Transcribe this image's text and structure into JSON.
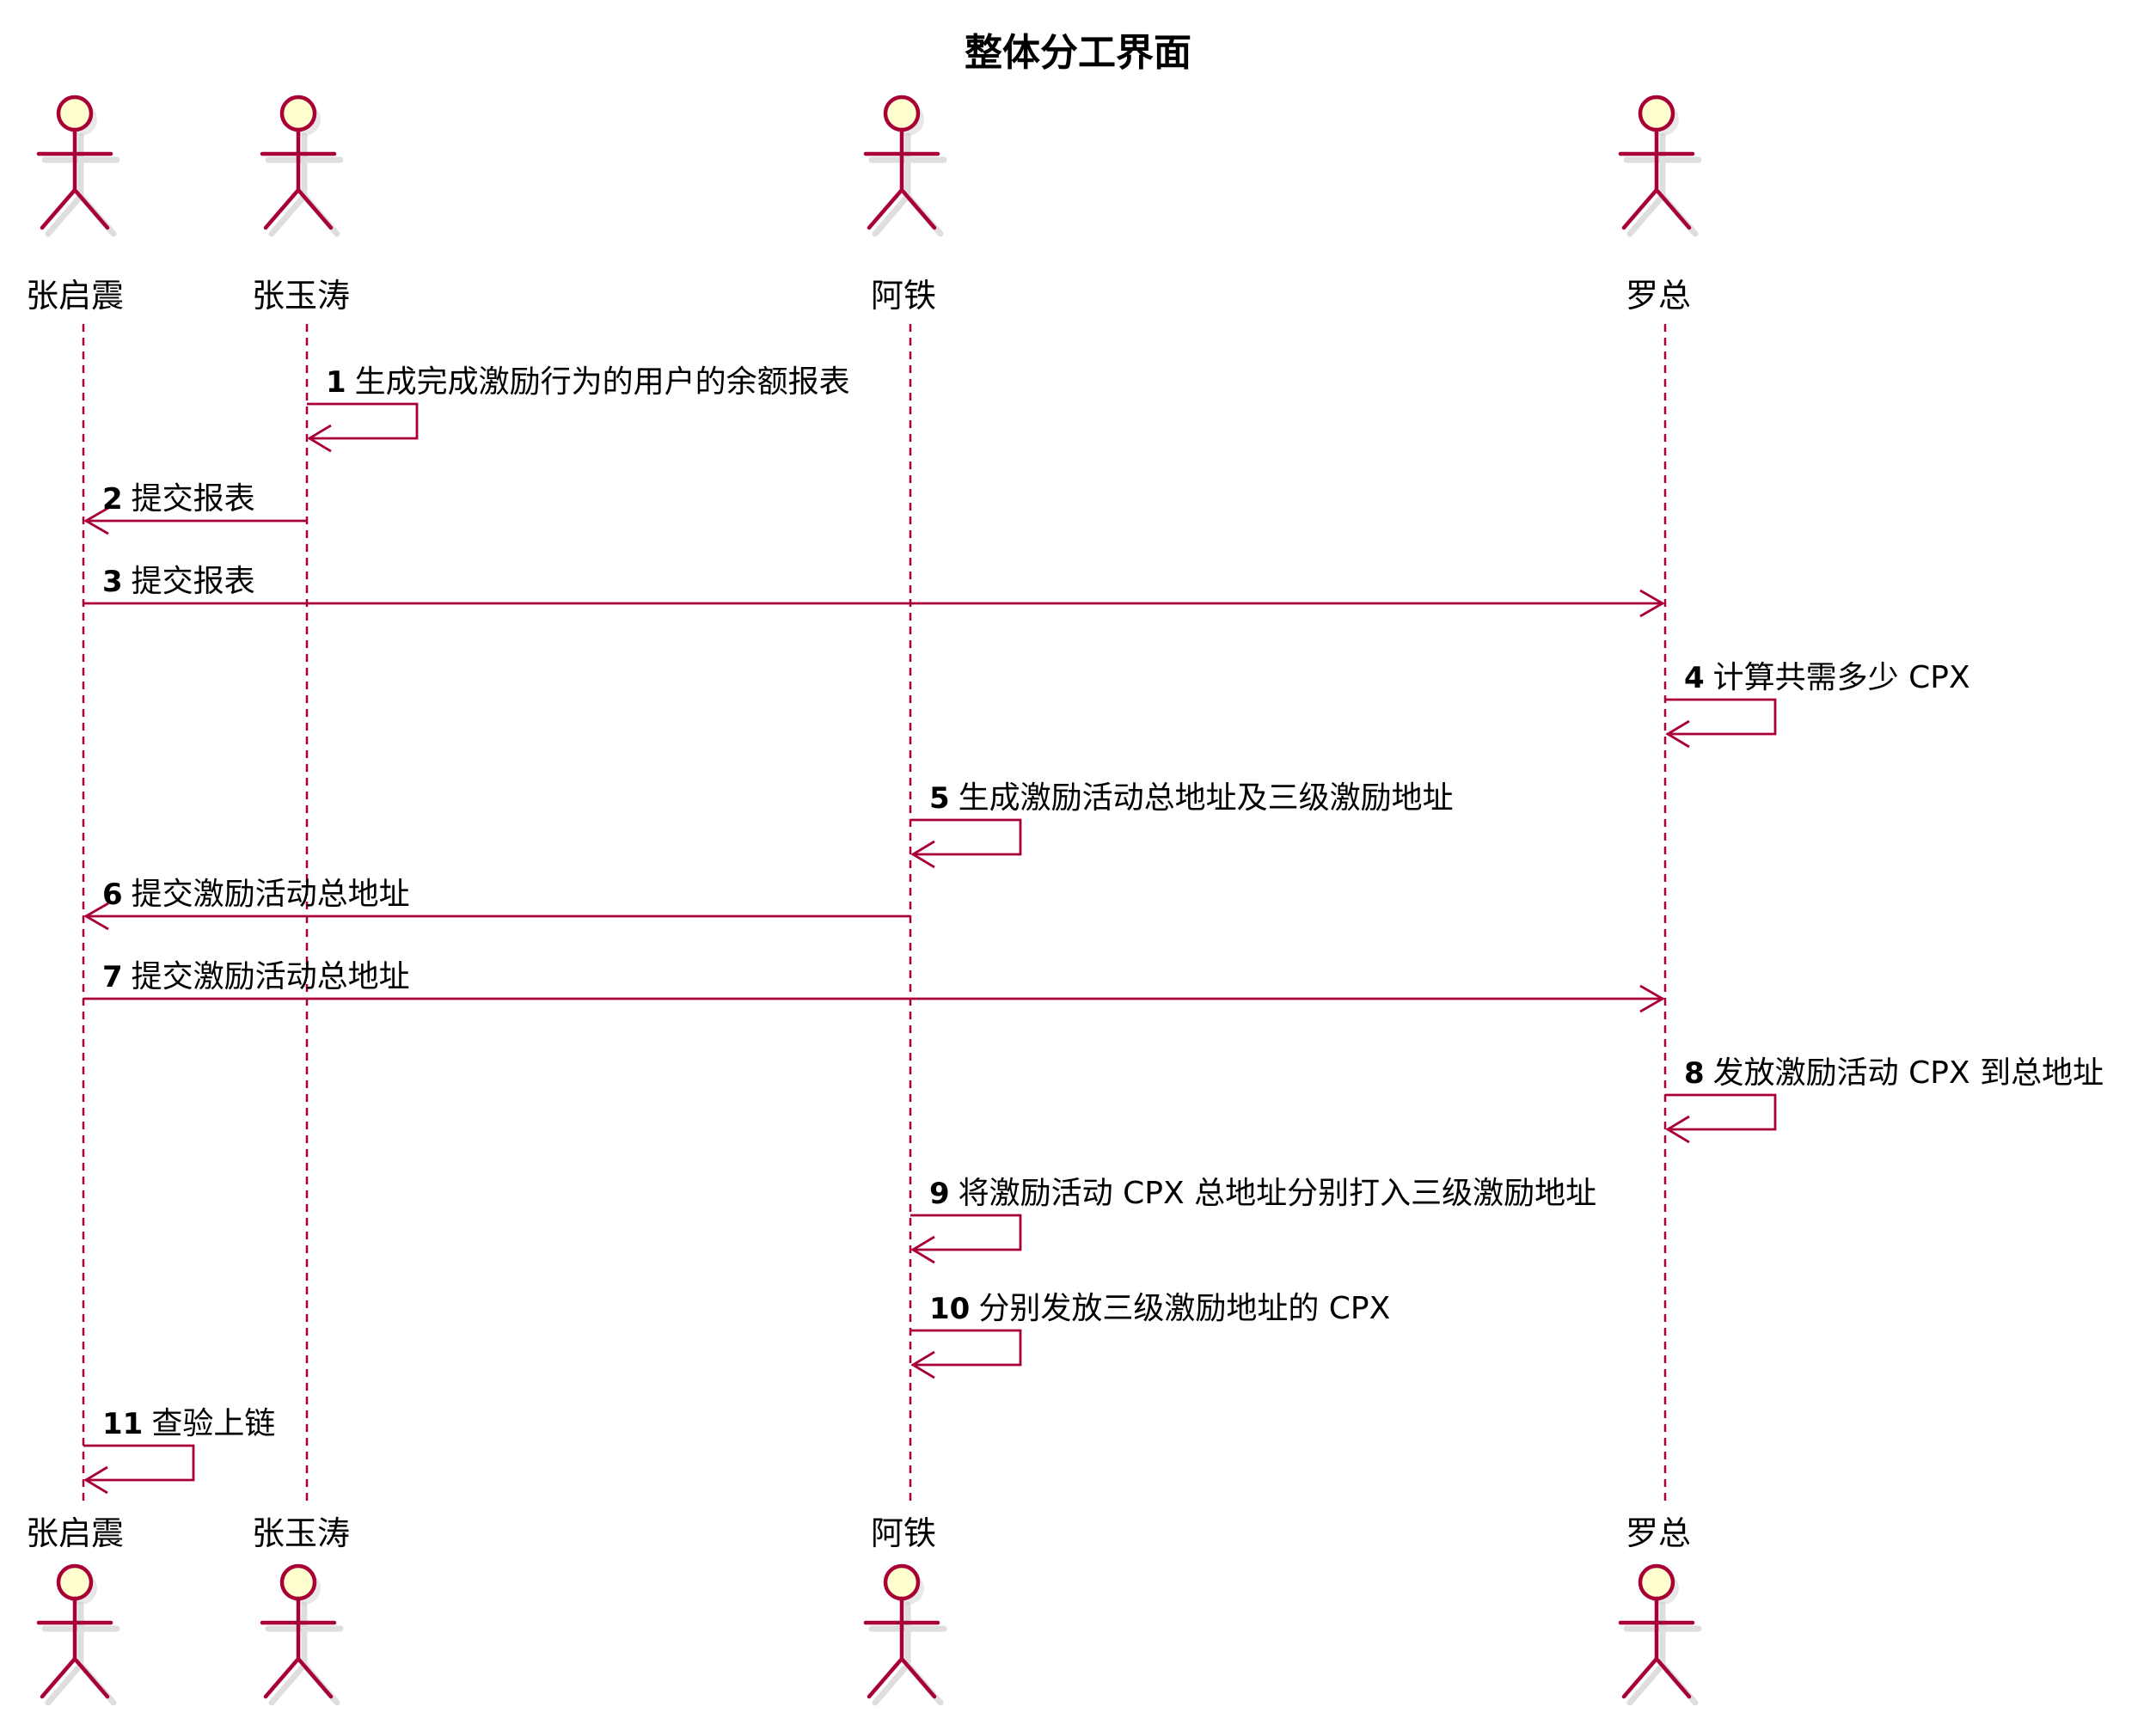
{
  "title": "整体分工界面",
  "colors": {
    "line": "#a80036",
    "actor_fill": "#fefece"
  },
  "participants": [
    {
      "id": "zqz",
      "name": "张启震"
    },
    {
      "id": "zyt",
      "name": "张玉涛"
    },
    {
      "id": "at",
      "name": "阿铁"
    },
    {
      "id": "lz",
      "name": "罗总"
    }
  ],
  "messages": [
    {
      "num": "1",
      "from": "zyt",
      "to": "zyt",
      "text": "生成完成激励行为的用户的余额报表"
    },
    {
      "num": "2",
      "from": "zyt",
      "to": "zqz",
      "text": "提交报表"
    },
    {
      "num": "3",
      "from": "zqz",
      "to": "lz",
      "text": "提交报表"
    },
    {
      "num": "4",
      "from": "lz",
      "to": "lz",
      "text": "计算共需多少 CPX"
    },
    {
      "num": "5",
      "from": "at",
      "to": "at",
      "text": "生成激励活动总地址及三级激励地址"
    },
    {
      "num": "6",
      "from": "at",
      "to": "zqz",
      "text": "提交激励活动总地址"
    },
    {
      "num": "7",
      "from": "zqz",
      "to": "lz",
      "text": "提交激励活动总地址"
    },
    {
      "num": "8",
      "from": "lz",
      "to": "lz",
      "text": "发放激励活动 CPX 到总地址"
    },
    {
      "num": "9",
      "from": "at",
      "to": "at",
      "text": "将激励活动 CPX 总地址分别打入三级激励地址"
    },
    {
      "num": "10",
      "from": "at",
      "to": "at",
      "text": "分别发放三级激励地址的 CPX"
    },
    {
      "num": "11",
      "from": "zqz",
      "to": "zqz",
      "text": "查验上链"
    }
  ]
}
